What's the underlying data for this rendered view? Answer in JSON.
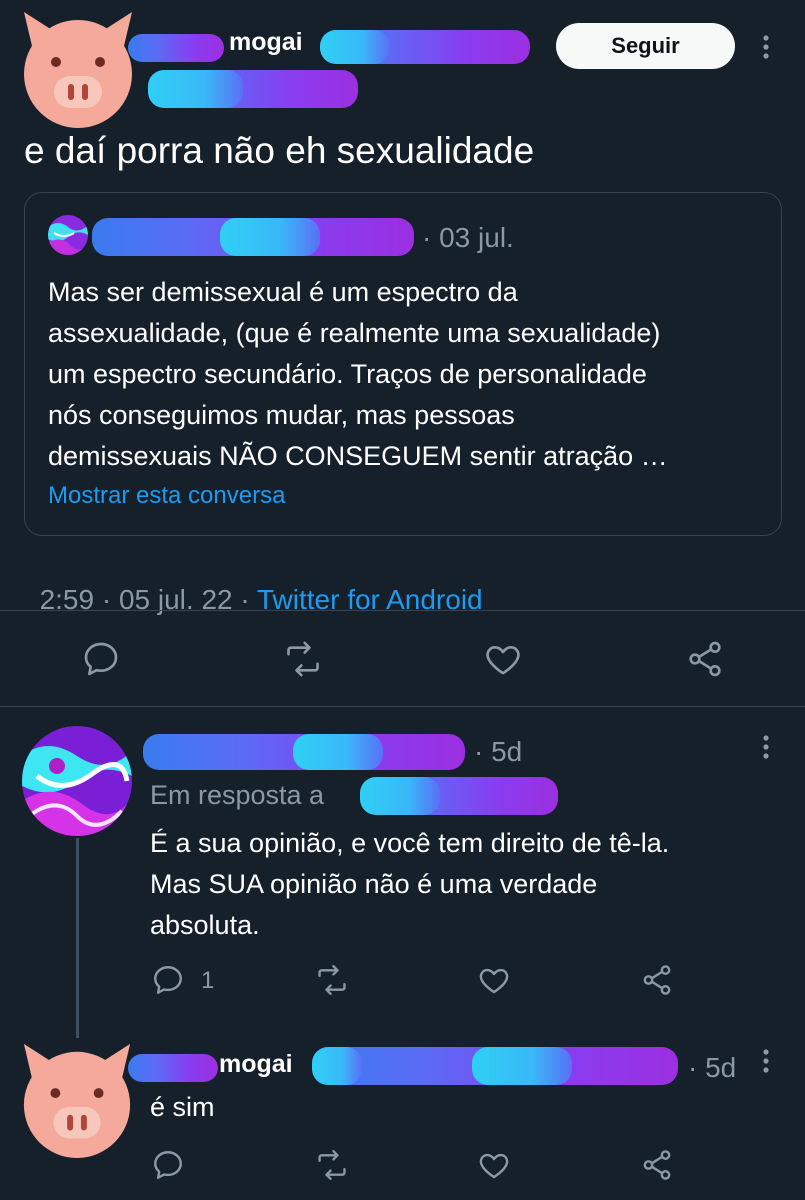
{
  "main_tweet": {
    "display_name_suffix": "mogai",
    "follow_label": "Seguir",
    "text": "e daí porra não eh sexualidade",
    "quoted": {
      "date": "· 03 jul.",
      "text_lines": [
        "Mas ser demissexual é um espectro da",
        "assexualidade, (que é realmente uma sexualidade)",
        "um espectro secundário. Traços de personalidade",
        "nós conseguimos mudar, mas pessoas",
        "demissexuais NÃO CONSEGUEM sentir atração …"
      ],
      "show_thread": "Mostrar esta conversa"
    },
    "meta_time": "2:59 · 05 jul. 22 · ",
    "meta_source": "Twitter for Android"
  },
  "reply_1": {
    "time": "· 5d",
    "replying_to": "Em resposta a",
    "text_lines": [
      "É a sua opinião, e você tem direito de tê-la.",
      "Mas SUA opinião não é uma verdade",
      "absoluta."
    ],
    "reply_count": "1"
  },
  "reply_2": {
    "display_name_suffix": "mogai",
    "time": "· 5d",
    "text": "é sim"
  },
  "icons": {
    "reply": "speech-bubble-icon",
    "retweet": "retweet-icon",
    "like": "heart-icon",
    "share": "share-icon",
    "more": "kebab-icon"
  },
  "colors": {
    "background": "#15202b",
    "accent": "#1d9bf0",
    "muted": "#8b98a5",
    "border": "#38444d",
    "avatar_pig": "#f4a99a"
  }
}
